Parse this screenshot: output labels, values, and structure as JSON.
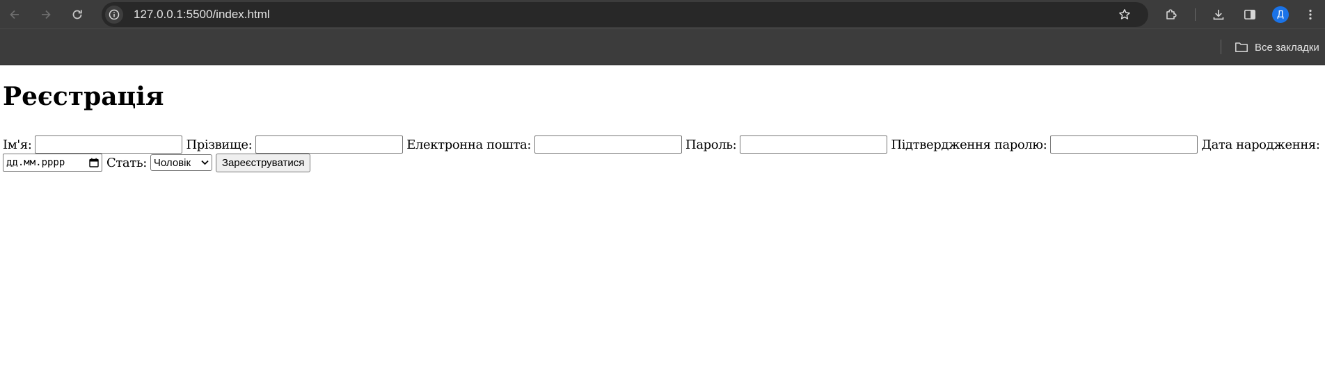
{
  "browser": {
    "url": "127.0.0.1:5500/index.html",
    "avatar_letter": "Д",
    "accent_color": "#1a73e8",
    "toolbar_icons": [
      "back-icon",
      "forward-icon",
      "reload-icon",
      "site-info-icon",
      "star-icon",
      "extensions-icon",
      "download-icon",
      "side-panel-icon",
      "menu-icon"
    ]
  },
  "bookmarks": {
    "all_bookmarks_label": "Все закладки"
  },
  "page": {
    "title": "Реєстрація",
    "form": {
      "first_name_label": "Ім'я:",
      "last_name_label": "Прізвище:",
      "email_label": "Електронна пошта:",
      "password_label": "Пароль:",
      "confirm_password_label": "Підтвердження паролю:",
      "birth_date_label": "Дата народження:",
      "birth_date_placeholder": "дд.мм.рррр",
      "gender_label": "Стать:",
      "gender_selected": "Чоловік",
      "submit_label": "Зареєструватися"
    }
  }
}
